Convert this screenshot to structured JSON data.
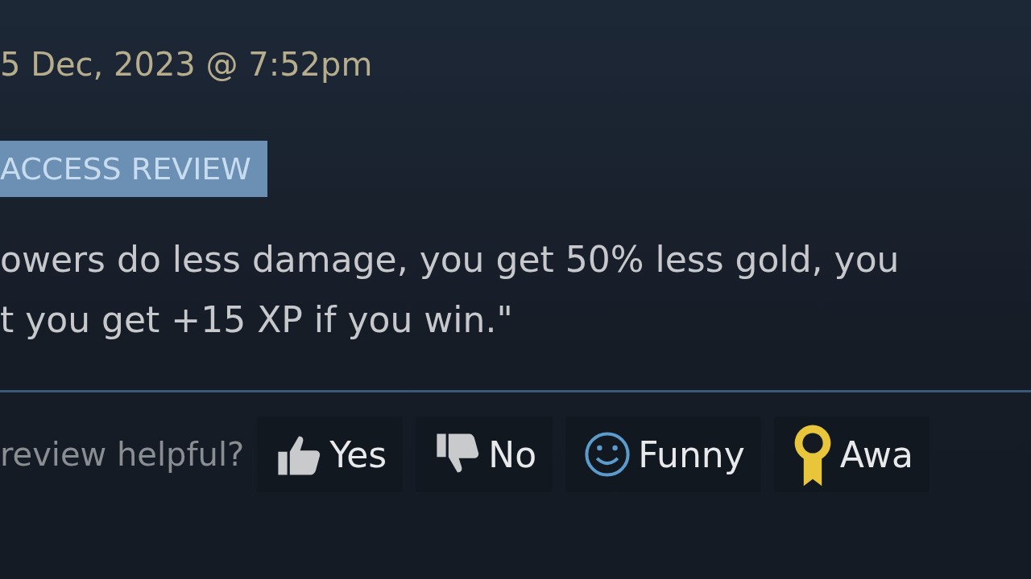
{
  "review": {
    "date": "5 Dec, 2023 @ 7:52pm",
    "badge": "ACCESS REVIEW",
    "body_lines": [
      "owers do less damage, you get 50% less gold, you",
      "t you get +15 XP if you win.\""
    ]
  },
  "feedback": {
    "prompt": "review helpful?",
    "buttons": [
      {
        "kind": "yes",
        "label": "Yes"
      },
      {
        "kind": "no",
        "label": "No"
      },
      {
        "kind": "funny",
        "label": "Funny"
      },
      {
        "kind": "award",
        "label": "Awa"
      }
    ]
  }
}
